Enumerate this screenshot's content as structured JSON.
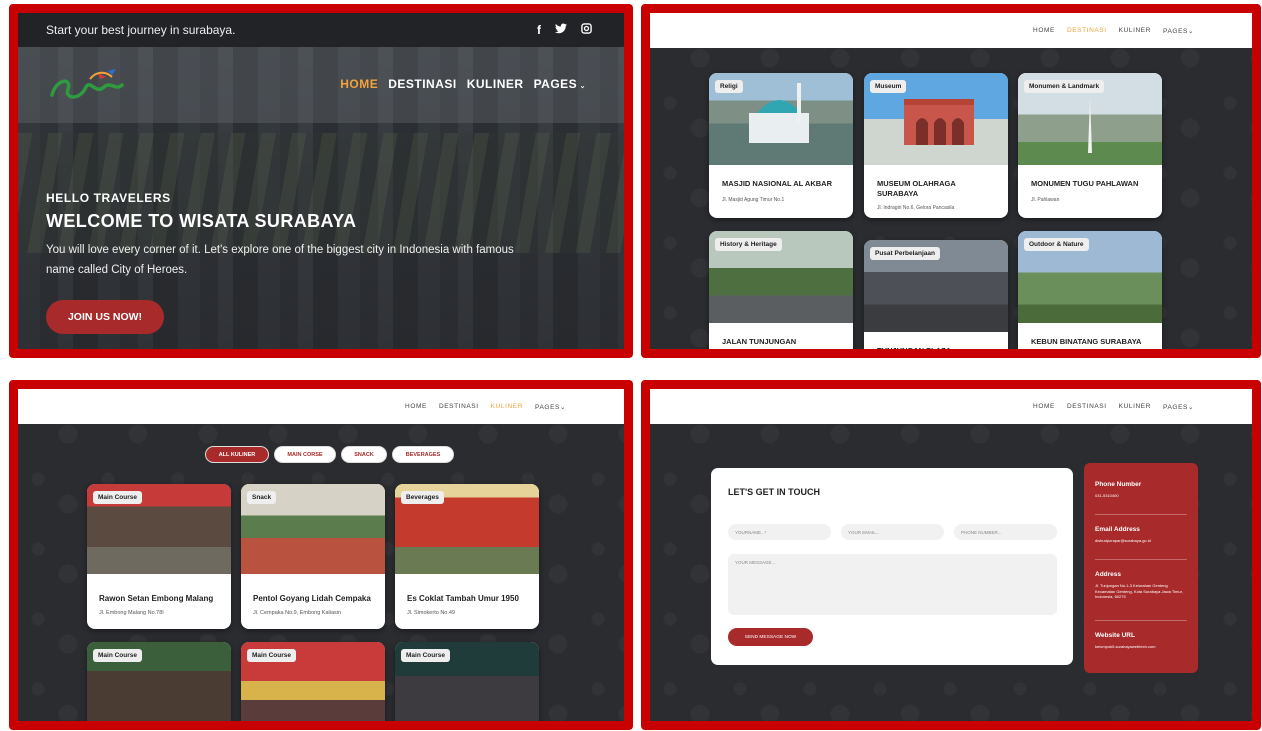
{
  "home": {
    "tagline": "Start your best journey in surabaya.",
    "social": [
      "f",
      "t",
      "ig"
    ],
    "logo_alt": "Surabaya",
    "nav": [
      "HOME",
      "DESTINASI",
      "KULINER",
      "PAGES"
    ],
    "active": "HOME",
    "hello": "HELLO TRAVELERS",
    "welcome": "WELCOME TO WISATA SURABAYA",
    "description": "You will love every corner of it. Let's explore one of the biggest city in Indonesia with famous name called City of Heroes.",
    "cta": "JOIN US NOW!"
  },
  "destinasi": {
    "nav": [
      "HOME",
      "DESTINASI",
      "KULINER",
      "PAGES"
    ],
    "active": "DESTINASI",
    "cards": [
      {
        "badge": "Religi",
        "title": "MASJID NASIONAL AL AKBAR",
        "address": "Jl. Masjid Agung Timur No.1"
      },
      {
        "badge": "Museum",
        "title": "MUSEUM OLAHRAGA SURABAYA",
        "address": "Jl. Indragiri No.6, Gelora Pancasila"
      },
      {
        "badge": "Monumen & Landmark",
        "title": "MONUMEN TUGU PAHLAWAN",
        "address": "Jl. Pahlawan"
      },
      {
        "badge": "History & Heritage",
        "title": "JALAN TUNJUNGAN",
        "address": ""
      },
      {
        "badge": "Pusat Perbelanjaan",
        "title": "TUNJUNGAN PLAZA",
        "address": ""
      },
      {
        "badge": "Outdoor & Nature",
        "title": "KEBUN BINATANG SURABAYA",
        "address": ""
      }
    ]
  },
  "kuliner": {
    "nav": [
      "HOME",
      "DESTINASI",
      "KULINER",
      "PAGES"
    ],
    "active": "KULINER",
    "filters": [
      "ALL KULINER",
      "MAIN CORSE",
      "SNACK",
      "BEVERAGES"
    ],
    "cards": [
      {
        "badge": "Main Course",
        "title": "Rawon Setan Embong Malang",
        "address": "Jl. Embong Malang No.78I"
      },
      {
        "badge": "Snack",
        "title": "Pentol Goyang Lidah Cempaka",
        "address": "Jl. Cempaka No.9, Embong Kaliasin"
      },
      {
        "badge": "Beverages",
        "title": "Es Coklat Tambah Umur 1950",
        "address": "Jl. Simokerto No.49"
      },
      {
        "badge": "Main Course",
        "title": "",
        "address": ""
      },
      {
        "badge": "Main Course",
        "title": "",
        "address": ""
      },
      {
        "badge": "Main Course",
        "title": "",
        "address": ""
      }
    ]
  },
  "contact": {
    "nav": [
      "HOME",
      "DESTINASI",
      "KULINER",
      "PAGES"
    ],
    "active": "PAGES",
    "title": "LET'S GET IN TOUCH",
    "ph_name": "YOURNAME...*",
    "ph_email": "YOUR EMAIL...",
    "ph_phone": "PHONE NUMBER...",
    "ph_message": "YOUR MESSAGE...",
    "send": "SEND MESSAGE NOW",
    "info": [
      {
        "label": "Phone Number",
        "value": "031-5310400"
      },
      {
        "label": "Email Address",
        "value": "disbudporapar@surabaya.go.id"
      },
      {
        "label": "Address",
        "value": "Jl. Tunjungan No.1-3 Kelurahan Genteng Kecamatan Genteng, Kota Surabaya Jawa Timur, Indonesia, 60275"
      },
      {
        "label": "Website URL",
        "value": "kelompok5.surabayawebtech.com"
      }
    ]
  }
}
